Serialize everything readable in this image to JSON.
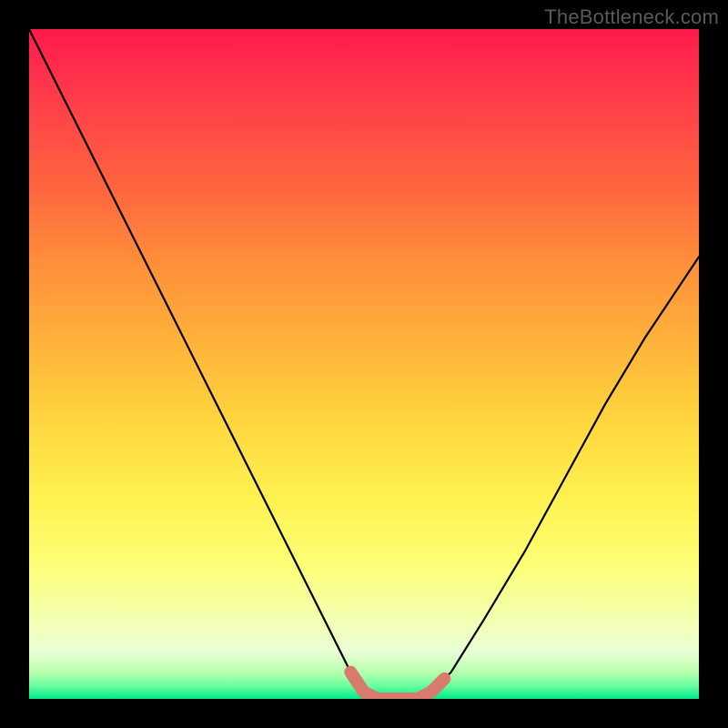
{
  "watermark": {
    "text": "TheBottleneck.com"
  },
  "chart_data": {
    "type": "line",
    "title": "",
    "xlabel": "",
    "ylabel": "",
    "xlim": [
      0,
      100
    ],
    "ylim": [
      0,
      100
    ],
    "grid": false,
    "legend": false,
    "series": [
      {
        "name": "curve",
        "color": "#000000",
        "x": [
          0,
          5,
          10,
          15,
          20,
          25,
          30,
          35,
          40,
          45,
          48,
          50,
          52,
          55,
          58,
          60,
          63,
          68,
          74,
          80,
          86,
          92,
          98,
          100
        ],
        "y": [
          100,
          90,
          80,
          70,
          60,
          50,
          40,
          30,
          20,
          10,
          4,
          1,
          0,
          0,
          0,
          1,
          4,
          12,
          22,
          33,
          44,
          54,
          63,
          66
        ]
      },
      {
        "name": "highlight",
        "color": "#d97a6f",
        "x": [
          48,
          50,
          52,
          55,
          58,
          60,
          62
        ],
        "y": [
          4,
          1,
          0,
          0,
          0,
          1,
          3
        ]
      }
    ],
    "background_gradient_stops": [
      {
        "pos": 0.0,
        "color": "#ff1a4d"
      },
      {
        "pos": 0.5,
        "color": "#ffc93c"
      },
      {
        "pos": 0.8,
        "color": "#fcff76"
      },
      {
        "pos": 1.0,
        "color": "#00e98b"
      }
    ]
  }
}
